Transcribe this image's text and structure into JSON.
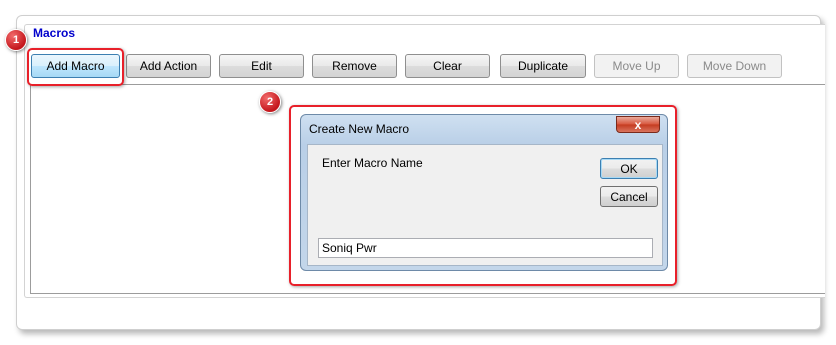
{
  "group": {
    "title": "Macros"
  },
  "toolbar": {
    "buttons": [
      {
        "label": "Add Macro",
        "enabled": true
      },
      {
        "label": "Add Action",
        "enabled": true
      },
      {
        "label": "Edit",
        "enabled": true
      },
      {
        "label": "Remove",
        "enabled": true
      },
      {
        "label": "Clear",
        "enabled": true
      },
      {
        "label": "Duplicate",
        "enabled": true
      },
      {
        "label": "Move Up",
        "enabled": false
      },
      {
        "label": "Move Down",
        "enabled": false
      }
    ]
  },
  "callouts": {
    "step1": "1",
    "step2": "2",
    "color": "#e8202a"
  },
  "dialog": {
    "title": "Create New Macro",
    "close_glyph": "x",
    "prompt": "Enter Macro Name",
    "ok_label": "OK",
    "cancel_label": "Cancel",
    "name_value": "Soniq Pwr"
  },
  "colors": {
    "group_title": "#0000cc",
    "close_button": "#c43a1f"
  }
}
